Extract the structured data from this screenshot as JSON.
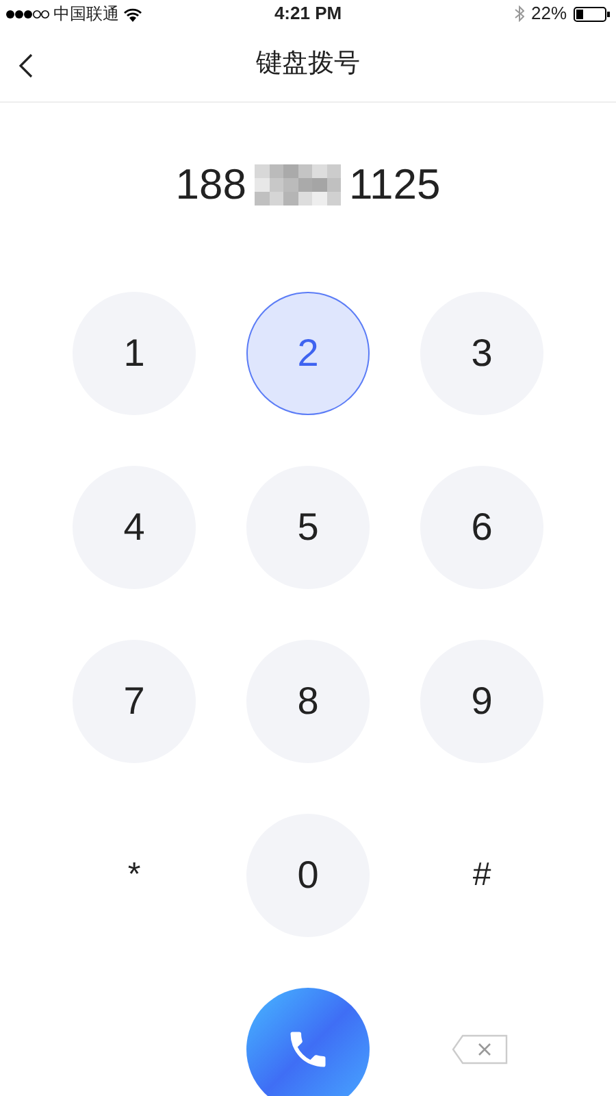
{
  "status_bar": {
    "carrier": "中国联通",
    "time": "4:21 PM",
    "battery": "22%"
  },
  "nav": {
    "title": "键盘拨号"
  },
  "number": {
    "prefix": "188",
    "suffix": "1125"
  },
  "keys": [
    {
      "label": "1",
      "kind": "digit",
      "selected": false
    },
    {
      "label": "2",
      "kind": "digit",
      "selected": true
    },
    {
      "label": "3",
      "kind": "digit",
      "selected": false
    },
    {
      "label": "4",
      "kind": "digit",
      "selected": false
    },
    {
      "label": "5",
      "kind": "digit",
      "selected": false
    },
    {
      "label": "6",
      "kind": "digit",
      "selected": false
    },
    {
      "label": "7",
      "kind": "digit",
      "selected": false
    },
    {
      "label": "8",
      "kind": "digit",
      "selected": false
    },
    {
      "label": "9",
      "kind": "digit",
      "selected": false
    },
    {
      "label": "*",
      "kind": "symbol",
      "selected": false
    },
    {
      "label": "0",
      "kind": "digit",
      "selected": false
    },
    {
      "label": "#",
      "kind": "symbol",
      "selected": false
    }
  ]
}
